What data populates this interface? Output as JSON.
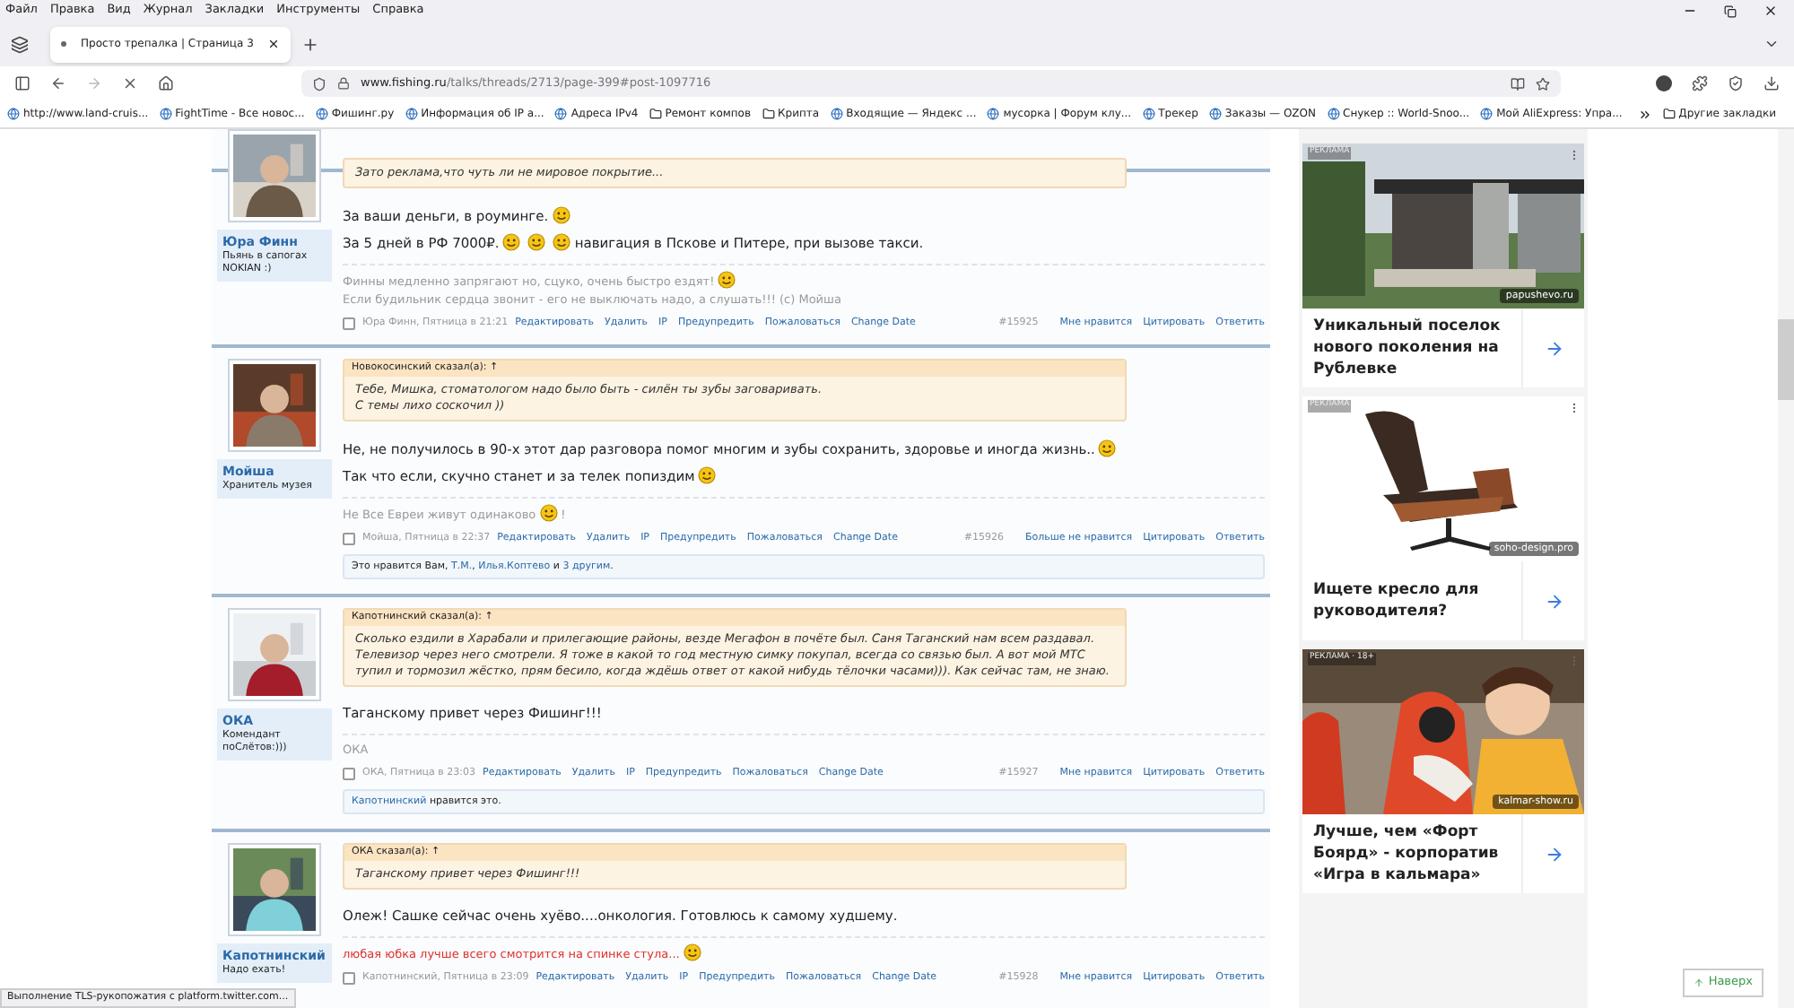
{
  "browser": {
    "menu": [
      "Файл",
      "Правка",
      "Вид",
      "Журнал",
      "Закладки",
      "Инструменты",
      "Справка"
    ],
    "tab": {
      "title": "Просто трепалка | Страница 3",
      "selected": true
    },
    "url": {
      "domain": "www.fishing.ru",
      "path": "/talks/threads/2713/page-399#post-1097716"
    },
    "bookmarks": [
      {
        "kind": "site",
        "label": "http://www.land-cruis..."
      },
      {
        "kind": "site",
        "label": "FightTime - Все новос..."
      },
      {
        "kind": "site",
        "label": "Фишинг.ру"
      },
      {
        "kind": "site",
        "label": "Информация об IP а..."
      },
      {
        "kind": "site",
        "label": "Адреса IPv4"
      },
      {
        "kind": "folder",
        "label": "Ремонт компов"
      },
      {
        "kind": "folder",
        "label": "Крипта"
      },
      {
        "kind": "site",
        "label": "Входящие — Яндекс ..."
      },
      {
        "kind": "site",
        "label": "мусорка | Форум клу..."
      },
      {
        "kind": "site",
        "label": "Трекер"
      },
      {
        "kind": "site",
        "label": "Заказы — OZON"
      },
      {
        "kind": "site",
        "label": "Снукер :: World-Snoo..."
      },
      {
        "kind": "site",
        "label": "Мой AliExpress: Упра..."
      }
    ],
    "other_bookmarks": "Другие закладки",
    "status": "Выполнение TLS-рукопожатия с platform.twitter.com..."
  },
  "posts": [
    {
      "user": {
        "name": "Юра Финн",
        "title": [
          "Пьянь в сапогах",
          "NOKIAN :)"
        ]
      },
      "quote": {
        "lines": [
          "Зато реклама,что чуть ли не мировое покрытие..."
        ]
      },
      "body": [
        [
          {
            "kind": "text",
            "text": "За ваши деньги, в роуминге."
          },
          {
            "kind": "smiley"
          }
        ],
        [
          {
            "kind": "text",
            "text": "За 5 дней в РФ 7000₽."
          },
          {
            "kind": "smiley"
          },
          {
            "kind": "smiley"
          },
          {
            "kind": "smiley"
          },
          {
            "kind": "text",
            "text": "навигация в Пскове и Питере, при вызове такси."
          }
        ]
      ],
      "signature": {
        "color": "#9a9a9a",
        "lines": [
          [
            {
              "kind": "text",
              "text": "Финны медленно запрягают но, сцуко, очень быстро ездят!"
            },
            {
              "kind": "smiley"
            }
          ],
          [
            {
              "kind": "text",
              "text": "Если будильник сердца звонит - его не выключать надо, а слушать!!! (с) Мойша"
            }
          ]
        ]
      },
      "meta": {
        "checked": false,
        "byline": "Юра Финн, Пятница в 21:21",
        "actions": [
          "Редактировать",
          "Удалить",
          "IP",
          "Предупредить",
          "Пожаловаться",
          "Change Date"
        ],
        "number": "#15925",
        "right_actions": [
          "Мне нравится",
          "Цитировать",
          "Ответить"
        ]
      }
    },
    {
      "user": {
        "name": "Мойша",
        "title": [
          "Хранитель музея"
        ]
      },
      "quote": {
        "author": "Новокосинский сказал(а): ↑",
        "lines": [
          "Тебе, Мишка, стоматологом надо было быть - силён ты зубы заговаривать.",
          "С темы лихо соскочил ))"
        ]
      },
      "body": [
        [
          {
            "kind": "text",
            "text": "Не, не получилось в 90-х этот дар разговора помог многим и зубы сохранить, здоровье и иногда жизнь.."
          },
          {
            "kind": "smiley"
          }
        ],
        [
          {
            "kind": "text",
            "text": "Так что если, скучно станет и за телек попиздим"
          },
          {
            "kind": "smiley"
          }
        ]
      ],
      "signature": {
        "color": "#9a9a9a",
        "lines": [
          [
            {
              "kind": "text",
              "text": "Не Все Евреи живут одинаково"
            },
            {
              "kind": "smiley"
            },
            {
              "kind": "text",
              "text": "!"
            }
          ]
        ]
      },
      "meta": {
        "checked": false,
        "byline": "Мойша, Пятница в 22:37",
        "actions": [
          "Редактировать",
          "Удалить",
          "IP",
          "Предупредить",
          "Пожаловаться",
          "Change Date"
        ],
        "number": "#15926",
        "right_actions": [
          "Больше не нравится",
          "Цитировать",
          "Ответить"
        ]
      },
      "likes": [
        {
          "kind": "text",
          "text": "Это нравится Вам, "
        },
        {
          "kind": "link",
          "text": "Т.М."
        },
        {
          "kind": "text",
          "text": ", "
        },
        {
          "kind": "link",
          "text": "Илья.Коптево"
        },
        {
          "kind": "text",
          "text": " и "
        },
        {
          "kind": "link",
          "text": "3 другим"
        },
        {
          "kind": "text",
          "text": "."
        }
      ]
    },
    {
      "user": {
        "name": "ОКА",
        "title": [
          "Комендант",
          "поСлётов:)))"
        ]
      },
      "quote": {
        "author": "Капотнинский сказал(а): ↑",
        "lines": [
          "Сколько ездили в Харабали и прилегающие районы, везде Мегафон в почёте был. Саня Таганский нам всем раздавал. Телевизор через него смотрели. Я тоже в какой то год местную симку покупал, всегда со связью был. А вот мой МТС тупил и тормозил жёстко, прям бесило, когда ждёшь ответ от какой нибудь тёлочки часами))). Как сейчас там, не знаю."
        ]
      },
      "body": [
        [
          {
            "kind": "text",
            "text": "Таганскому привет через Фишинг!!!"
          }
        ]
      ],
      "signature": {
        "color": "#9a9a9a",
        "lines": [
          [
            {
              "kind": "text",
              "text": "ОКА"
            }
          ]
        ]
      },
      "meta": {
        "checked": false,
        "byline": "ОКА, Пятница в 23:03",
        "actions": [
          "Редактировать",
          "Удалить",
          "IP",
          "Предупредить",
          "Пожаловаться",
          "Change Date"
        ],
        "number": "#15927",
        "right_actions": [
          "Мне нравится",
          "Цитировать",
          "Ответить"
        ]
      },
      "likes": [
        {
          "kind": "link",
          "text": "Капотнинский"
        },
        {
          "kind": "text",
          "text": " нравится это."
        }
      ]
    },
    {
      "user": {
        "name": "Капотнинский",
        "title": [
          "Надо ехать!"
        ]
      },
      "quote": {
        "author": "ОКА сказал(а): ↑",
        "lines": [
          "Таганскому привет через Фишинг!!!"
        ]
      },
      "body": [
        [
          {
            "kind": "text",
            "text": "Олеж! Сашке сейчас очень хуёво....онкология. Готовлюсь к самому худшему."
          }
        ]
      ],
      "signature": {
        "color": "#e0312b",
        "lines": [
          [
            {
              "kind": "text",
              "text": "любая юбка лучше всего смотрится на спинке стула..."
            },
            {
              "kind": "smiley"
            }
          ]
        ]
      },
      "meta": {
        "checked": false,
        "byline": "Капотнинский, Пятница в 23:09",
        "actions": [
          "Редактировать",
          "Удалить",
          "IP",
          "Предупредить",
          "Пожаловаться",
          "Change Date"
        ],
        "number": "#15928",
        "right_actions": [
          "Мне нравится",
          "Цитировать",
          "Ответить"
        ]
      }
    }
  ],
  "ads": [
    {
      "label": "РЕКЛАМА",
      "domain": "papushevo.ru",
      "title": "Уникальный поселок нового поколения на Рублевке",
      "kind": "house"
    },
    {
      "label": "РЕКЛАМА",
      "domain": "soho-design.pro",
      "title": "Ищете кресло для руководителя?",
      "kind": "chair"
    },
    {
      "label": "РЕКЛАМА · 18+",
      "domain": "kalmar-show.ru",
      "title": "Лучше, чем «Форт Боярд» - корпоратив «Игра в кальмара»",
      "kind": "people"
    }
  ],
  "back_to_top": "Наверх"
}
